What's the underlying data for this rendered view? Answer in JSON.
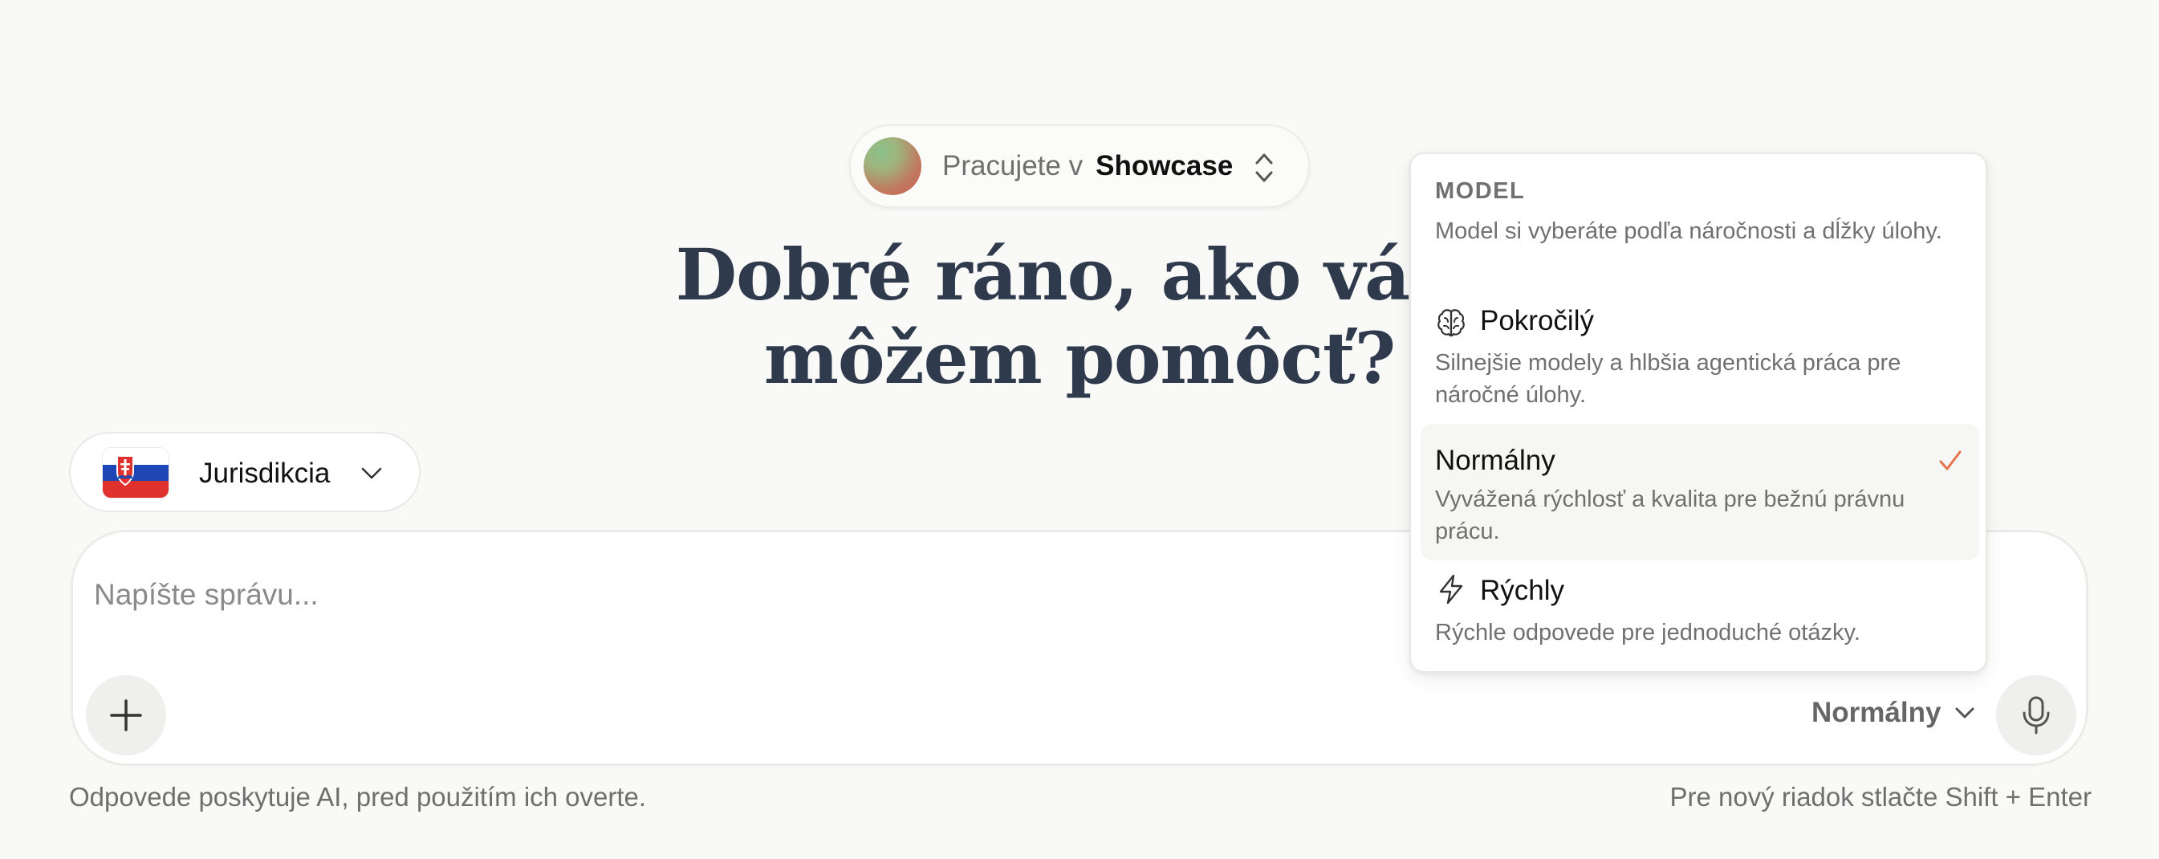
{
  "workspace": {
    "prefix": "Pracujete v",
    "name": "Showcase"
  },
  "greeting": "Dobré ráno, ako vám môžem pomôcť?",
  "jurisdiction": {
    "label": "Jurisdikcia",
    "flag": "slovakia-flag-icon"
  },
  "composer": {
    "placeholder": "Napíšte správu...",
    "model_selected": "Normálny"
  },
  "footer": {
    "disclaimer": "Odpovede poskytuje AI, pred použitím ich overte.",
    "hint": "Pre nový riadok stlačte Shift + Enter"
  },
  "model_menu": {
    "heading": "MODEL",
    "description": "Model si vyberáte podľa náročnosti a dĺžky úlohy.",
    "items": [
      {
        "title": "Pokročilý",
        "subtitle": "Silnejšie modely a hlbšia agentická práca pre náročné úlohy.",
        "icon": "brain-icon",
        "selected": false
      },
      {
        "title": "Normálny",
        "subtitle": "Vyvážená rýchlosť a kvalita pre bežnú právnu prácu.",
        "icon": "",
        "selected": true
      },
      {
        "title": "Rýchly",
        "subtitle": "Rýchle odpovede pre jednoduché otázky.",
        "icon": "lightning-icon",
        "selected": false
      }
    ]
  },
  "colors": {
    "accent_check": "#e8744f",
    "heading_text": "#2f3a4c",
    "background": "#f9f9f8"
  }
}
